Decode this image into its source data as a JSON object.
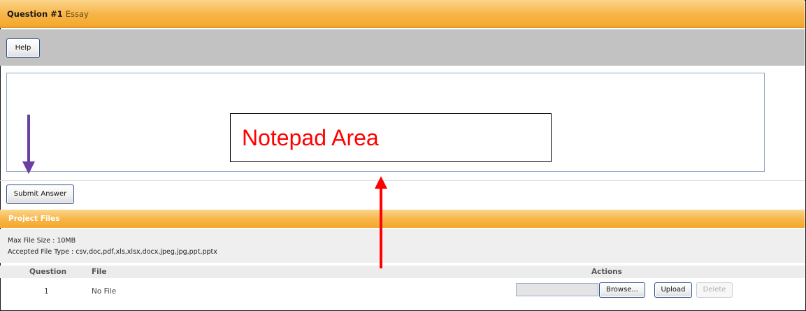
{
  "question": {
    "number_label": "Question #1",
    "type_label": "Essay"
  },
  "toolbar": {
    "help_label": "Help"
  },
  "answer": {
    "submit_label": "Submit Answer"
  },
  "annotation": {
    "callout_text": "Notepad Area",
    "callout_color": "#ff0000",
    "purple_arrow_color": "#6a3fa0",
    "red_arrow_color": "#ff0000"
  },
  "project_files": {
    "title": "Project Files",
    "max_size": "Max File Size : 10MB",
    "accepted_types": "Accepted File Type : csv,doc,pdf,xls,xlsx,docx,jpeg,jpg,ppt,pptx",
    "columns": {
      "question": "Question",
      "file": "File",
      "actions": "Actions"
    },
    "rows": [
      {
        "question": "1",
        "file": "No File",
        "browse_label": "Browse...",
        "upload_label": "Upload",
        "delete_label": "Delete"
      }
    ]
  },
  "colors": {
    "header_orange": "#f7b446",
    "toolbar_gray": "#c2c2c2",
    "button_border": "#2f4f88"
  }
}
